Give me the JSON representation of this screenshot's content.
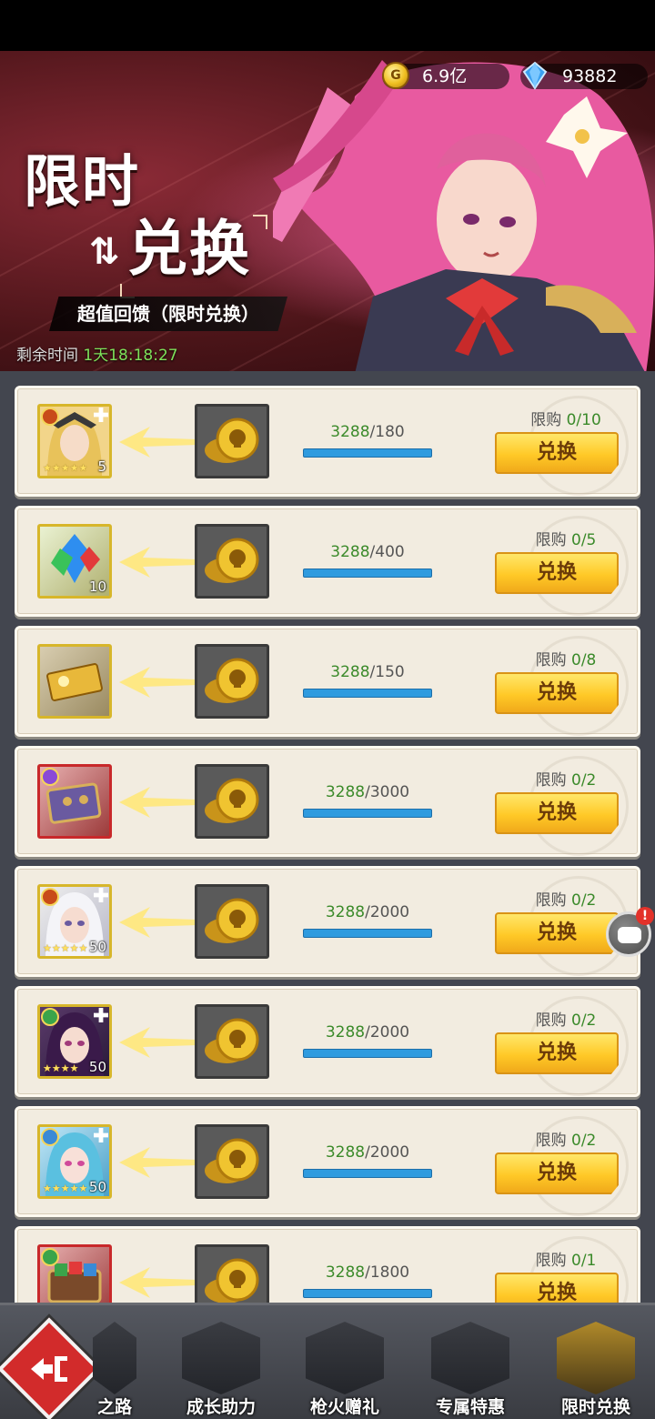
{
  "header": {
    "gold": "6.9亿",
    "gems": "93882",
    "title_line1": "限时",
    "title_line2": "兑换",
    "subtitle": "超值回馈（限时兑换）",
    "timer_label": "剩余时间",
    "timer_value": "1天18:18:27"
  },
  "exchange": {
    "button_label": "兑换",
    "limit_label": "限购",
    "items": [
      {
        "icon": "hero-portrait-icon",
        "qty": "5",
        "have": "3288",
        "need": "180",
        "limit": "0/10"
      },
      {
        "icon": "crystal-icon",
        "qty": "10",
        "have": "3288",
        "need": "400",
        "limit": "0/5"
      },
      {
        "icon": "ticket-icon",
        "qty": "",
        "have": "3288",
        "need": "150",
        "limit": "0/8"
      },
      {
        "icon": "treasure-box-icon",
        "qty": "",
        "have": "3288",
        "need": "3000",
        "limit": "0/2"
      },
      {
        "icon": "hero-portrait-icon",
        "qty": "50",
        "have": "3288",
        "need": "2000",
        "limit": "0/2"
      },
      {
        "icon": "hero-portrait-icon",
        "qty": "50",
        "have": "3288",
        "need": "2000",
        "limit": "0/2"
      },
      {
        "icon": "hero-portrait-icon",
        "qty": "50",
        "have": "3288",
        "need": "2000",
        "limit": "0/2"
      },
      {
        "icon": "treasure-box-icon",
        "qty": "",
        "have": "3288",
        "need": "1800",
        "limit": "0/1"
      }
    ]
  },
  "chat": {
    "badge": "!"
  },
  "nav": {
    "tabs": [
      {
        "label": "之路"
      },
      {
        "label": "成长助力"
      },
      {
        "label": "枪火赠礼"
      },
      {
        "label": "专属特惠"
      },
      {
        "label": "限时兑换"
      }
    ]
  },
  "colors": {
    "accent_gold": "#ffc927",
    "progress_blue": "#2f9bdf",
    "text_green": "#3b8a2a"
  }
}
